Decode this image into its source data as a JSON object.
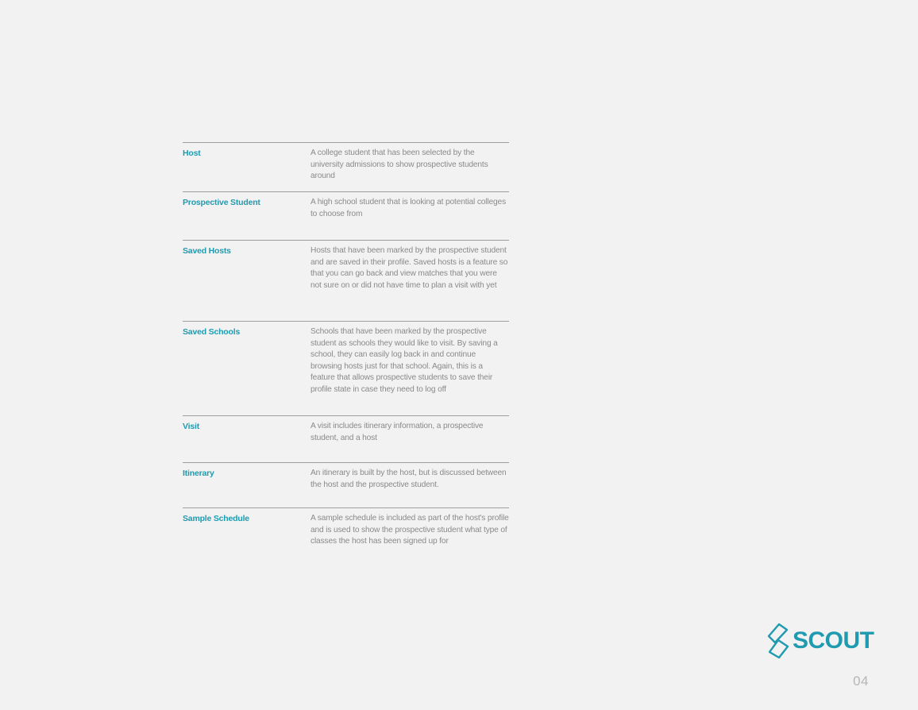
{
  "glossary": [
    {
      "term": "Host",
      "definition": "A college student that has been selected by the university admissions to show prospective students around"
    },
    {
      "term": "Prospective Student",
      "definition": "A high school student that is looking at potential colleges to choose from"
    },
    {
      "term": "Saved Hosts",
      "definition": "Hosts that have been marked by the prospective student and are saved in their profile. Saved hosts is a feature so that you can go back and view matches that you were not sure on or did not have time to plan a visit with yet"
    },
    {
      "term": "Saved Schools",
      "definition": "Schools that have been marked by the prospective student as schools they would like to visit. By saving a school, they can easily log back in and continue browsing hosts just for that school. Again, this is a feature that allows prospective students to save their profile state in case they need to log off"
    },
    {
      "term": "Visit",
      "definition": "A visit includes itinerary information, a prospective student, and a host"
    },
    {
      "term": "Itinerary",
      "definition": "An itinerary is built by the host, but is discussed between the host and the prospective student."
    },
    {
      "term": "Sample Schedule",
      "definition": "A sample schedule is included as part of the host's profile and is used to show the prospective student what type of classes the host has been signed up for"
    }
  ],
  "logo": {
    "text": "SCOUT",
    "icon": "scout-logo-mark",
    "color": "#1f9bb0"
  },
  "page_number": "04"
}
